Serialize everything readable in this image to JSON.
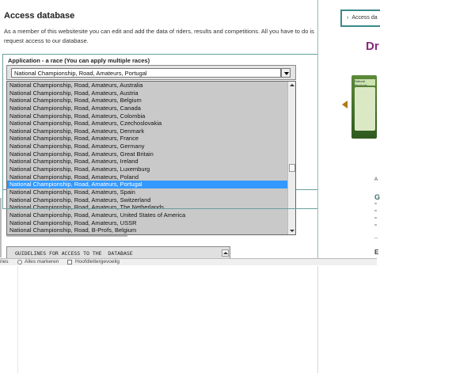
{
  "main": {
    "title": "Access database",
    "intro": "As a member of this websitesite you can edit and add the data of riders, results and competitions. All you have to do is request access to our database.",
    "application_label": "Application - a race (You can apply multiple races)",
    "select_value": "National Championship, Road, Amateurs, Portugal",
    "options": [
      "National Championship, Road, Amateurs, Australia",
      "National Championship, Road, Amateurs, Austria",
      "National Championship, Road, Amateurs, Belgium",
      "National Championship, Road, Amateurs, Canada",
      "National Championship, Road, Amateurs, Colombia",
      "National Championship, Road, Amateurs, Czechoslovakia",
      "National Championship, Road, Amateurs, Denmark",
      "National Championship, Road, Amateurs, France",
      "National Championship, Road, Amateurs, Germany",
      "National Championship, Road, Amateurs, Great Britain",
      "National Championship, Road, Amateurs, Ireland",
      "National Championship, Road, Amateurs, Luxemburg",
      "National Championship, Road, Amateurs, Poland",
      "National Championship, Road, Amateurs, Portugal",
      "National Championship, Road, Amateurs, Spain",
      "National Championship, Road, Amateurs, Switzerland",
      "National Championship, Road, Amateurs, The Netherlands",
      "National Championship, Road, Amateurs, United States of America",
      "National Championship, Road, Amateurs, USSR",
      "National Championship, Road, B-Profs, Belgium"
    ],
    "selected_index": 13,
    "guidelines_text": "GUIDELINES FOR ACCESS TO THE  DATABASE"
  },
  "find_bar": {
    "prefix": "ries",
    "mark_all": "Alles markeren",
    "match_case": "Hoofdlettergevoelig"
  },
  "sidebar": {
    "tab_label": "Access da",
    "brand_text": "Dr",
    "product_label": "Natural Products",
    "side_letter_a": "A",
    "side_letter_g": "G",
    "side_letter_e": "E"
  },
  "colors": {
    "selection": "#3399ff",
    "accent": "#3a8a8a",
    "brand": "#8a2a7a"
  },
  "icons": [
    "chevron-down-icon",
    "scroll-up-icon",
    "scroll-down-icon",
    "tab-arrow-icon",
    "carousel-prev-icon"
  ]
}
